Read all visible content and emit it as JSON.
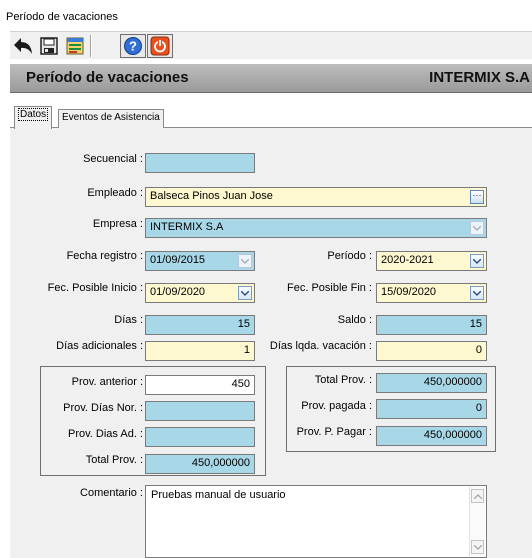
{
  "window": {
    "title": "Período de vacaciones"
  },
  "toolbar": {
    "icons": [
      "back-arrow-icon",
      "save-icon",
      "report-icon",
      "help-icon",
      "exit-icon"
    ]
  },
  "header": {
    "title": "Período de vacaciones",
    "company": "INTERMIX S.A"
  },
  "tabs": [
    {
      "label": "Datos",
      "active": true
    },
    {
      "label": "Eventos de Asistencia",
      "active": false
    }
  ],
  "form": {
    "secuencial": {
      "label": "Secuencial :",
      "value": ""
    },
    "empleado": {
      "label": "Empleado :",
      "value": "Balseca Pinos Juan Jose"
    },
    "empresa": {
      "label": "Empresa :",
      "value": "INTERMIX S.A"
    },
    "fecha_registro": {
      "label": "Fecha registro :",
      "value": "01/09/2015"
    },
    "periodo": {
      "label": "Período :",
      "value": "2020-2021"
    },
    "fec_posible_inicio": {
      "label": "Fec. Posible Inicio :",
      "value": "01/09/2020"
    },
    "fec_posible_fin": {
      "label": "Fec. Posible Fin :",
      "value": "15/09/2020"
    },
    "dias": {
      "label": "Días :",
      "value": "15"
    },
    "saldo": {
      "label": "Saldo :",
      "value": "15"
    },
    "dias_adicionales": {
      "label": "Días adicionales :",
      "value": "1"
    },
    "dias_lqda": {
      "label": "Días lqda. vacación :",
      "value": "0"
    },
    "prov_anterior": {
      "label": "Prov. anterior :",
      "value": "450"
    },
    "prov_dias_nor": {
      "label": "Prov. Días Nor. :",
      "value": ""
    },
    "prov_dias_ad": {
      "label": "Prov. Dias Ad. :",
      "value": ""
    },
    "total_prov_left": {
      "label": "Total Prov. :",
      "value": "450,000000"
    },
    "total_prov_right": {
      "label": "Total Prov. :",
      "value": "450,000000"
    },
    "prov_pagada": {
      "label": "Prov. pagada :",
      "value": "0"
    },
    "prov_p_pagar": {
      "label": "Prov. P. Pagar :",
      "value": "450,000000"
    },
    "comentario": {
      "label": "Comentario :",
      "value": "Pruebas manual de usuario"
    }
  },
  "colors": {
    "field_blue": "#a8d8e8",
    "field_yellow": "#fdf8cf",
    "banner_gray": "#a8a8a8"
  }
}
